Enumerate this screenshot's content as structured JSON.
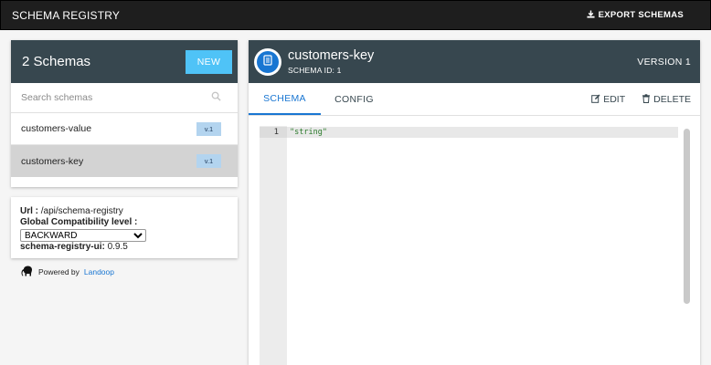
{
  "topbar": {
    "title": "SCHEMA REGISTRY",
    "export_label": "EXPORT SCHEMAS"
  },
  "sidebar": {
    "count_label": "2 Schemas",
    "new_button": "NEW",
    "search_placeholder": "Search schemas",
    "items": [
      {
        "name": "customers-value",
        "version": "v.1",
        "selected": false
      },
      {
        "name": "customers-key",
        "version": "v.1",
        "selected": true
      }
    ]
  },
  "info": {
    "url_label": "Url :",
    "url_value": "/api/schema-registry",
    "compat_label": "Global Compatibility level :",
    "compat_value": "BACKWARD",
    "ui_label": "schema-registry-ui:",
    "ui_version": "0.9.5",
    "powered_by": "Powered by",
    "powered_link": "Landoop"
  },
  "detail": {
    "title": "customers-key",
    "schema_id_label": "SCHEMA ID: 1",
    "version_label": "VERSION 1",
    "tabs": [
      {
        "label": "SCHEMA",
        "active": true
      },
      {
        "label": "CONFIG",
        "active": false
      }
    ],
    "edit_label": "EDIT",
    "delete_label": "DELETE"
  },
  "editor": {
    "line_number": "1",
    "code": "\"string\""
  },
  "colors": {
    "header_bg": "#37474f",
    "accent": "#4fc3f7",
    "tab_active": "#1976d2",
    "topbar_bg": "#1e1e1e"
  }
}
